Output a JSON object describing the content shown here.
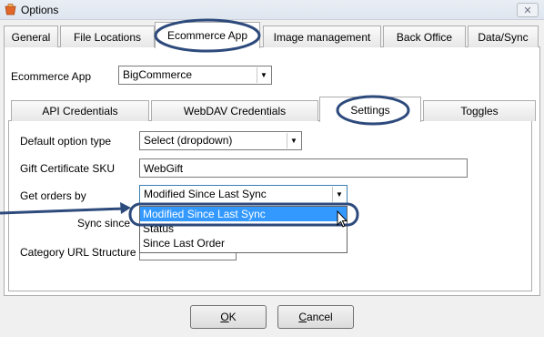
{
  "window": {
    "title": "Options",
    "close_glyph": "✕",
    "icon": "app-icon"
  },
  "main_tabs": [
    {
      "label": "General"
    },
    {
      "label": "File Locations"
    },
    {
      "label": "Ecommerce App"
    },
    {
      "label": "Image management"
    },
    {
      "label": "Back Office"
    },
    {
      "label": "Data/Sync"
    }
  ],
  "ecommerce": {
    "label": "Ecommerce App",
    "value": "BigCommerce"
  },
  "sub_tabs": [
    {
      "label": "API Credentials"
    },
    {
      "label": "WebDAV Credentials"
    },
    {
      "label": "Settings"
    },
    {
      "label": "Toggles"
    }
  ],
  "settings": {
    "default_option_type": {
      "label": "Default option type",
      "value": "Select (dropdown)"
    },
    "gift_certificate_sku": {
      "label": "Gift Certificate SKU",
      "value": "WebGift"
    },
    "get_orders_by": {
      "label": "Get orders by",
      "value": "Modified Since Last Sync"
    },
    "sync_since": {
      "label": "Sync since"
    },
    "category_url_structure": {
      "label": "Category URL Structure"
    }
  },
  "dropdown_options": [
    {
      "label": "Modified Since Last Sync",
      "selected": true
    },
    {
      "label": "Status",
      "selected": false
    },
    {
      "label": "Since Last Order",
      "selected": false
    }
  ],
  "buttons": {
    "ok": {
      "mnemonic": "O",
      "rest": "K"
    },
    "cancel": {
      "mnemonic": "C",
      "rest": "ancel"
    }
  },
  "colors": {
    "annotation": "#2d4a7c",
    "selection": "#3399ff"
  }
}
